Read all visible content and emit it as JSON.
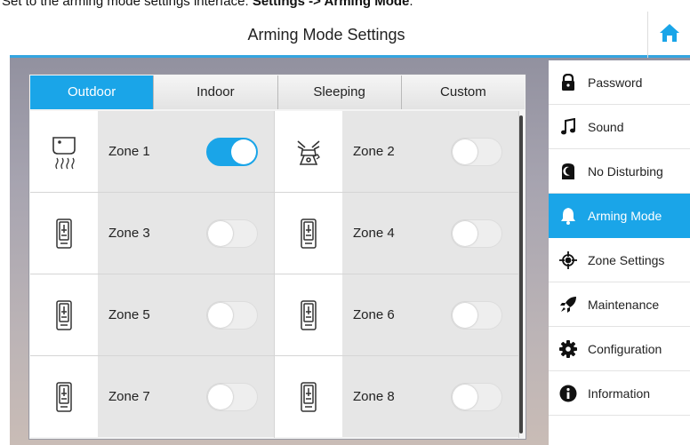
{
  "caption": {
    "prefix": "Set to the arming mode settings interface: ",
    "path": "Settings -> Arming Mode",
    "suffix": "."
  },
  "header": {
    "title": "Arming Mode Settings",
    "home_icon": "home-icon"
  },
  "tabs": [
    {
      "label": "Outdoor",
      "active": true
    },
    {
      "label": "Indoor",
      "active": false
    },
    {
      "label": "Sleeping",
      "active": false
    },
    {
      "label": "Custom",
      "active": false
    }
  ],
  "zones": [
    {
      "label": "Zone 1",
      "icon": "smoke-detector-icon",
      "enabled": true
    },
    {
      "label": "Zone 2",
      "icon": "gas-sensor-icon",
      "enabled": false
    },
    {
      "label": "Zone 3",
      "icon": "door-sensor-icon",
      "enabled": false
    },
    {
      "label": "Zone 4",
      "icon": "door-sensor-icon",
      "enabled": false
    },
    {
      "label": "Zone 5",
      "icon": "door-sensor-icon",
      "enabled": false
    },
    {
      "label": "Zone 6",
      "icon": "door-sensor-icon",
      "enabled": false
    },
    {
      "label": "Zone 7",
      "icon": "door-sensor-icon",
      "enabled": false
    },
    {
      "label": "Zone 8",
      "icon": "door-sensor-icon",
      "enabled": false
    }
  ],
  "sidebar": {
    "items": [
      {
        "label": "Password",
        "icon": "lock-icon",
        "active": false
      },
      {
        "label": "Sound",
        "icon": "music-note-icon",
        "active": false
      },
      {
        "label": "No Disturbing",
        "icon": "moon-icon",
        "active": false
      },
      {
        "label": "Arming Mode",
        "icon": "bell-icon",
        "active": true
      },
      {
        "label": "Zone Settings",
        "icon": "crosshair-icon",
        "active": false
      },
      {
        "label": "Maintenance",
        "icon": "rocket-icon",
        "active": false
      },
      {
        "label": "Configuration",
        "icon": "gear-icon",
        "active": false
      },
      {
        "label": "Information",
        "icon": "info-icon",
        "active": false
      }
    ]
  },
  "colors": {
    "accent": "#1aa5e8",
    "title_underline": "#34a5e0"
  }
}
